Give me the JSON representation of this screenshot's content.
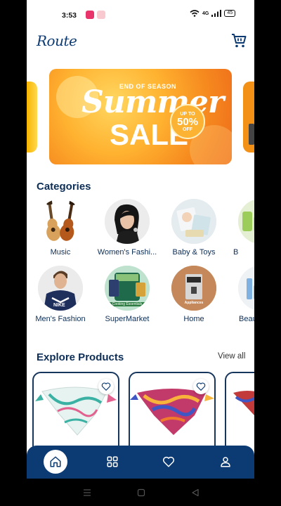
{
  "status_bar": {
    "time": "3:53",
    "network": "4G",
    "battery": "45"
  },
  "header": {
    "logo": "Route"
  },
  "banner": {
    "eyebrow": "END OF SEASON",
    "headline": "Summer",
    "subheadline": "SALE",
    "badge_top": "UP TO",
    "badge_value": "50%",
    "badge_bottom": "OFF"
  },
  "categories": {
    "title": "Categories",
    "row1": [
      {
        "label": "Music",
        "icon": "guitar-icon"
      },
      {
        "label": "Women's Fashi...",
        "icon": "woman-portrait-icon"
      },
      {
        "label": "Baby & Toys",
        "icon": "baby-products-icon"
      },
      {
        "label": "B",
        "icon": "beauty-icon"
      }
    ],
    "row2": [
      {
        "label": "Men's Fashion",
        "icon": "man-portrait-icon"
      },
      {
        "label": "SuperMarket",
        "icon": "grocery-icon"
      },
      {
        "label": "Home",
        "icon": "coffee-machine-icon"
      },
      {
        "label": "Beauty",
        "icon": "cosmetics-icon"
      }
    ],
    "home_sub": "Appliances",
    "supermarket_sub": "Cooking Essentials"
  },
  "products": {
    "title": "Explore Products",
    "view_all": "View all"
  },
  "colors": {
    "primary": "#0c3a73",
    "title": "#0d2e57",
    "banner": "#f68a1f"
  }
}
